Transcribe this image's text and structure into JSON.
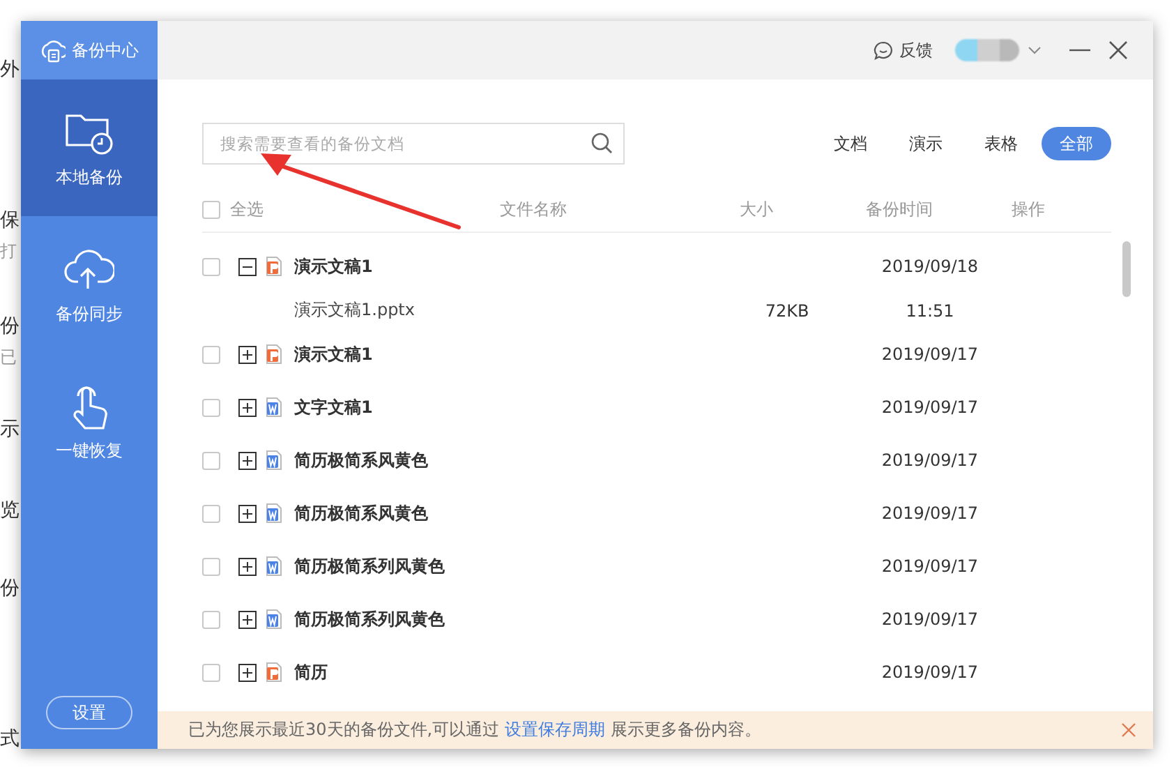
{
  "background_page": {
    "texts": [
      "外",
      "保",
      "打",
      "份",
      "已",
      "示",
      "览",
      "份",
      "式"
    ]
  },
  "window": {
    "title": "备份中心",
    "feedback": "反馈"
  },
  "sidebar": {
    "items": [
      {
        "label": "本地备份",
        "kind": "backup",
        "selected": true
      },
      {
        "label": "备份同步",
        "kind": "sync",
        "selected": false
      },
      {
        "label": "一键恢复",
        "kind": "restore",
        "selected": false
      }
    ],
    "settings": "设置"
  },
  "search": {
    "placeholder": "搜索需要查看的备份文档"
  },
  "filters": [
    {
      "label": "文档",
      "selected": false
    },
    {
      "label": "演示",
      "selected": false
    },
    {
      "label": "表格",
      "selected": false
    },
    {
      "label": "全部",
      "selected": true
    }
  ],
  "table": {
    "select_all": {
      "label": "全选",
      "checked": false
    },
    "columns": [
      "文件名称",
      "大小",
      "备份时间",
      "操作"
    ],
    "rows": [
      {
        "kind": "presentation",
        "name": "演示文稿1",
        "date": "2019/09/18",
        "checked": false,
        "expanded": true,
        "children": [
          {
            "name": "演示文稿1.pptx",
            "size": "72KB",
            "time": "11:51"
          }
        ]
      },
      {
        "kind": "presentation",
        "name": "演示文稿1",
        "date": "2019/09/17",
        "checked": false,
        "expanded": false
      },
      {
        "kind": "document",
        "name": "文字文稿1",
        "date": "2019/09/17",
        "checked": false,
        "expanded": false
      },
      {
        "kind": "document",
        "name": "简历极简系风黄色",
        "date": "2019/09/17",
        "checked": false,
        "expanded": false
      },
      {
        "kind": "document",
        "name": "简历极简系风黄色",
        "date": "2019/09/17",
        "checked": false,
        "expanded": false
      },
      {
        "kind": "document",
        "name": "简历极简系列风黄色",
        "date": "2019/09/17",
        "checked": false,
        "expanded": false
      },
      {
        "kind": "document",
        "name": "简历极简系列风黄色",
        "date": "2019/09/17",
        "checked": false,
        "expanded": false
      },
      {
        "kind": "presentation",
        "name": "简历",
        "date": "2019/09/17",
        "checked": false,
        "expanded": false
      }
    ]
  },
  "notice": {
    "text": "已为您展示最近30天的备份文件,可以通过",
    "link": "设置保存周期",
    "text_after": "展示更多备份内容。"
  }
}
